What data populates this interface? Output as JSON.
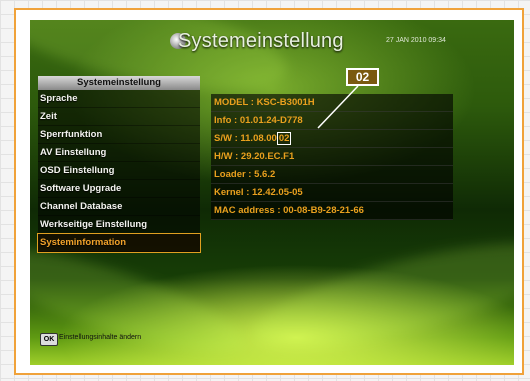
{
  "screen": {
    "title": "Systemeinstellung",
    "datetime": "27 JAN 2010 09:34"
  },
  "menu": {
    "header": "Systemeinstellung",
    "items": [
      {
        "label": "Sprache"
      },
      {
        "label": "Zeit"
      },
      {
        "label": "Sperrfunktion"
      },
      {
        "label": "AV Einstellung"
      },
      {
        "label": "OSD Einstellung"
      },
      {
        "label": "Software Upgrade"
      },
      {
        "label": "Channel Database"
      },
      {
        "label": "Werkseitige Einstellung"
      },
      {
        "label": "Systeminformation",
        "selected": true
      }
    ]
  },
  "info": {
    "model": "MODEL : KSC-B3001H",
    "info": "Info : 01.01.24-D778",
    "sw_prefix": "S/W : 11.08.00",
    "sw_highlight": "02",
    "hw": "H/W : 29.20.EC.F1",
    "loader": "Loader : 5.6.2",
    "kernel": "Kernel : 12.42.05-05",
    "mac": "MAC address : 00-08-B9-28-21-66"
  },
  "callout": {
    "label": "02"
  },
  "footer": {
    "key": "OK",
    "hint": "Einstellungsinhalte ändern"
  },
  "colors": {
    "accent": "#e9a01e",
    "frame": "#f0a23a"
  }
}
